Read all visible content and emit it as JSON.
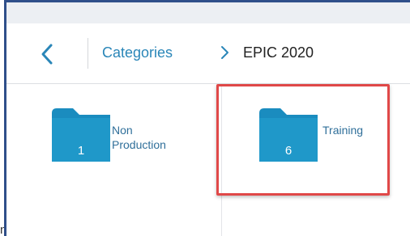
{
  "breadcrumb": {
    "parent_label": "Categories",
    "current_label": "EPIC 2020"
  },
  "folders": [
    {
      "label_line1": "Non",
      "label_line2": "Production",
      "count": "1",
      "color": "#1a8cbf"
    },
    {
      "label_line1": "Training",
      "label_line2": "",
      "count": "6",
      "color": "#1a8cbf"
    }
  ],
  "highlight_color": "#e04848",
  "icons": {
    "back": "chevron-left-icon",
    "separator": "chevron-right-icon",
    "folder": "folder-icon"
  },
  "stray_text": "n"
}
